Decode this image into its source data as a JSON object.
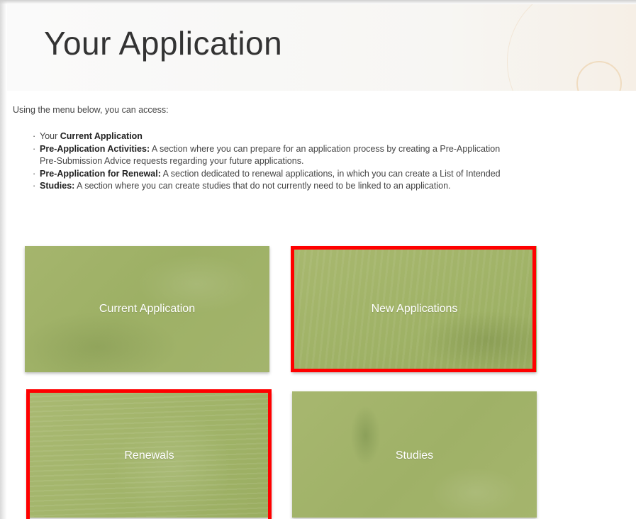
{
  "header": {
    "title": "Your Application"
  },
  "intro": {
    "text": "Using the menu below, you can access:"
  },
  "items": [
    {
      "prefix": "Your ",
      "bold": "Current Application",
      "text": ""
    },
    {
      "prefix": "",
      "bold": "Pre-Application Activities:",
      "text": " A section where you can prepare for an application process by creating a Pre-Application",
      "continuation": "Pre-Submission Advice requests regarding your future applications."
    },
    {
      "prefix": "",
      "bold": "Pre-Application for Renewal:",
      "text": " A section dedicated to renewal applications, in which you can create a List of Intended"
    },
    {
      "prefix": "",
      "bold": "Studies:",
      "text": " A section where you can create studies that do not currently need to be linked to an application."
    }
  ],
  "tiles": [
    {
      "label": "Current Application",
      "highlighted": false
    },
    {
      "label": "New Applications",
      "highlighted": true
    },
    {
      "label": "Renewals",
      "highlighted": true
    },
    {
      "label": "Studies",
      "highlighted": false
    }
  ],
  "colors": {
    "highlight": "#ff0000",
    "tile_green": "#a3b46c",
    "title_text": "#333333"
  }
}
